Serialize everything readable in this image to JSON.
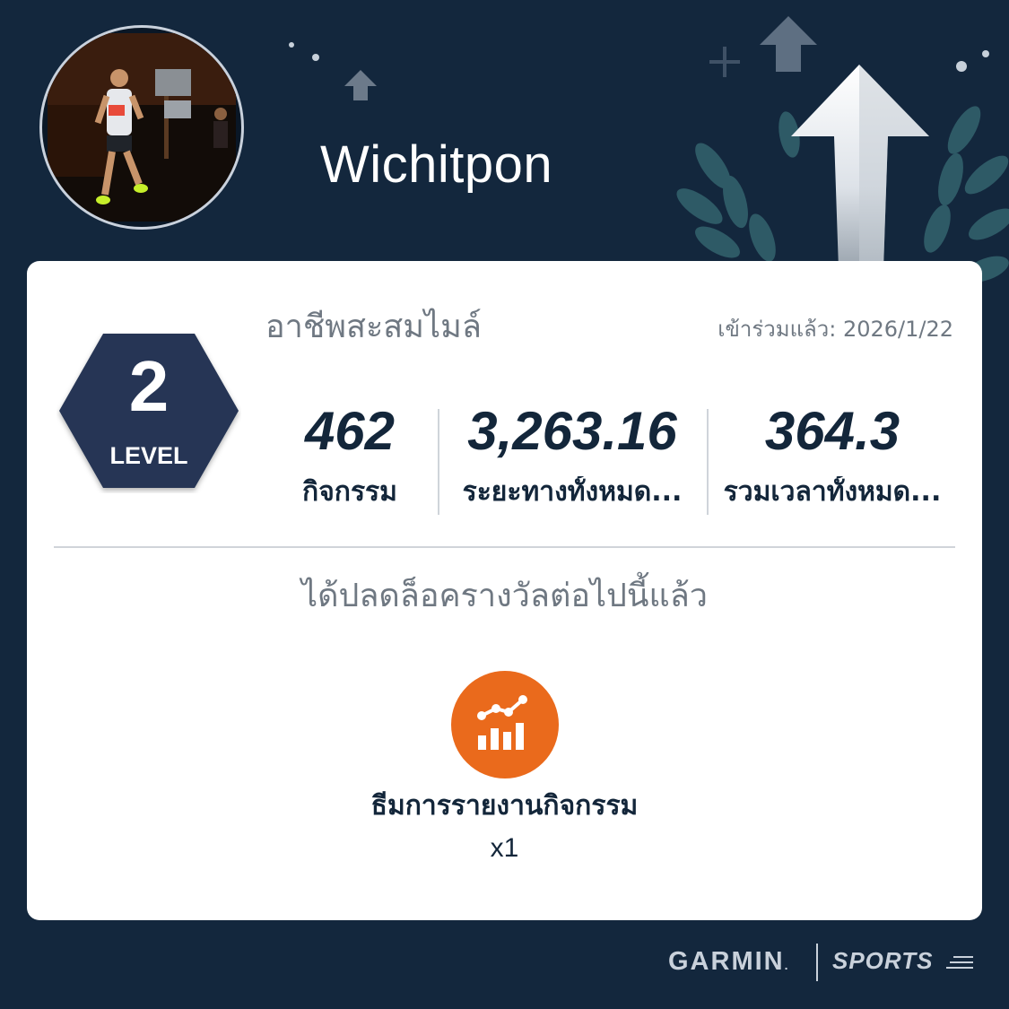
{
  "profile": {
    "username": "Wichitpon",
    "avatar_desc": "runner-photo"
  },
  "level": {
    "number": "2",
    "word": "LEVEL",
    "title": "อาชีพสะสมไมล์",
    "joined": "เข้าร่วมแล้ว: 2026/1/22"
  },
  "stats": [
    {
      "value": "462",
      "label": "กิจกรรม"
    },
    {
      "value": "3,263.16",
      "label": "ระยะทางทั้งหมด..."
    },
    {
      "value": "364.3",
      "label": "รวมเวลาทั้งหมด..."
    }
  ],
  "rewards": {
    "heading": "ได้ปลดล็อครางวัลต่อไปนี้แล้ว",
    "items": [
      {
        "name": "ธีมการรายงานกิจกรรม",
        "count": "x1",
        "icon": "activity-report-chart-icon"
      }
    ]
  },
  "footer": {
    "brand": "GARMIN",
    "brand_mark": ".",
    "product": "SPORTS"
  },
  "colors": {
    "background": "#13273d",
    "accent_orange": "#ea6a1c",
    "text_dark": "#13263a",
    "text_muted": "#6f7882"
  }
}
